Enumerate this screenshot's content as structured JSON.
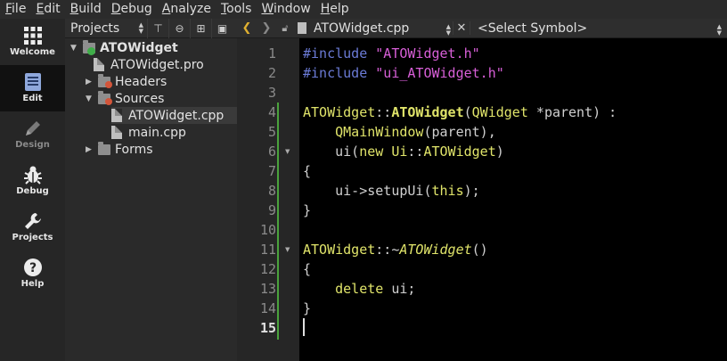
{
  "menu": [
    "File",
    "Edit",
    "Build",
    "Debug",
    "Analyze",
    "Tools",
    "Window",
    "Help"
  ],
  "menu_underline": [
    "F",
    "E",
    "B",
    "D",
    "A",
    "T",
    "W",
    "H"
  ],
  "modes": [
    {
      "label": "Welcome",
      "icon": "grid-icon",
      "active": false,
      "dim": false
    },
    {
      "label": "Edit",
      "icon": "document-icon",
      "active": true,
      "dim": false
    },
    {
      "label": "Design",
      "icon": "pencil-icon",
      "active": false,
      "dim": true
    },
    {
      "label": "Debug",
      "icon": "bug-icon",
      "active": false,
      "dim": false
    },
    {
      "label": "Projects",
      "icon": "wrench-icon",
      "active": false,
      "dim": false
    },
    {
      "label": "Help",
      "icon": "question-icon",
      "active": false,
      "dim": false
    }
  ],
  "project_toolbar": {
    "view_label": "Projects"
  },
  "tree": [
    {
      "label": "ATOWidget",
      "type": "project",
      "arrow": "▼",
      "bold": true
    },
    {
      "label": "ATOWidget.pro",
      "type": "file",
      "arrow": ""
    },
    {
      "label": "Headers",
      "type": "folder",
      "arrow": "▶"
    },
    {
      "label": "Sources",
      "type": "folder",
      "arrow": "▼"
    },
    {
      "label": "ATOWidget.cpp",
      "type": "file",
      "arrow": "",
      "selected": true
    },
    {
      "label": "main.cpp",
      "type": "file",
      "arrow": ""
    },
    {
      "label": "Forms",
      "type": "folder",
      "arrow": "▶"
    }
  ],
  "editor_toolbar": {
    "file_name": "ATOWidget.cpp",
    "symbol": "<Select Symbol>",
    "close_symbol": "✕"
  },
  "editor": {
    "current_line": 15,
    "line_numbers": [
      "1",
      "2",
      "3",
      "4",
      "5",
      "6",
      "7",
      "8",
      "9",
      "10",
      "11",
      "12",
      "13",
      "14",
      "15"
    ],
    "fold_markers_at": [
      6,
      11
    ]
  },
  "colors": {
    "preprocessor": "#6b7bd6",
    "string": "#d85fd8",
    "identifier": "#e0e46a",
    "change_bar": "#4aa23c",
    "nav_arrow": "#e0b030"
  }
}
